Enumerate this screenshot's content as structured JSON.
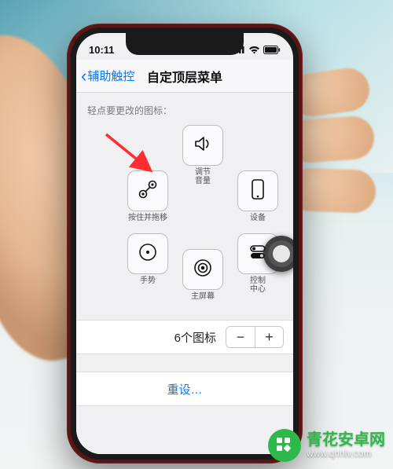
{
  "status": {
    "time": "10:11"
  },
  "nav": {
    "back": "辅助触控",
    "title": "自定顶层菜单"
  },
  "section_label": "轻点要更改的图标：",
  "icons": {
    "volume": {
      "label": "调节\n音量"
    },
    "pinch": {
      "label": "按住并拖移"
    },
    "device": {
      "label": "设备"
    },
    "gestures": {
      "label": "手势"
    },
    "home": {
      "label": "主屏幕"
    },
    "control": {
      "label": "控制\n中心"
    }
  },
  "stepper": {
    "count_label": "6个图标",
    "minus": "−",
    "plus": "+"
  },
  "reset_label": "重设…",
  "watermark": {
    "title": "青花安卓网",
    "url": "www.qhhlv.com"
  },
  "colors": {
    "accent": "#007aff",
    "arrow": "#ff2d2d",
    "brand_green": "#2fb84a"
  }
}
